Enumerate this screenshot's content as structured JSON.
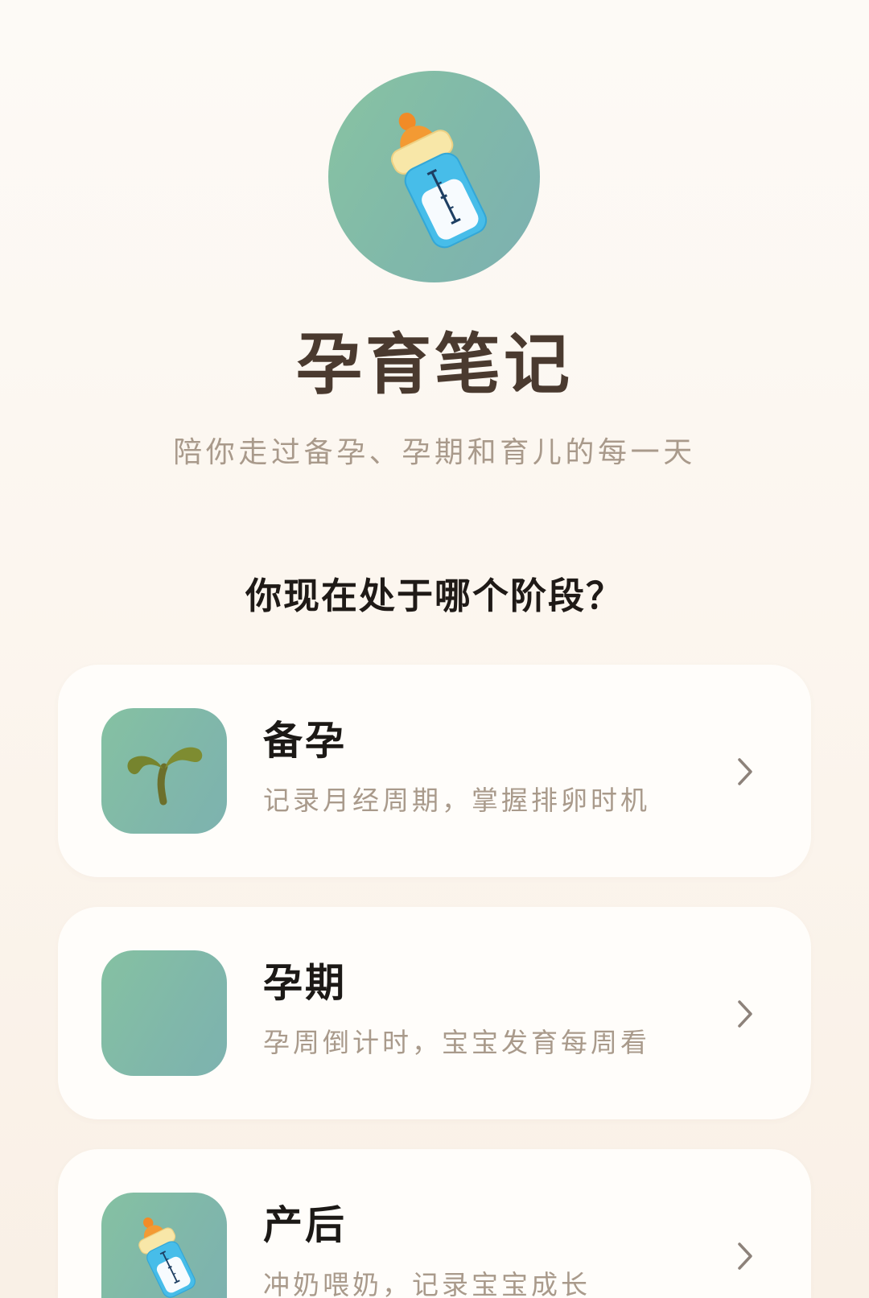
{
  "app": {
    "title": "孕育笔记",
    "subtitle": "陪你走过备孕、孕期和育儿的每一天",
    "logo_icon": "baby-bottle-icon"
  },
  "stage_prompt": "你现在处于哪个阶段？",
  "stages": [
    {
      "label": "备孕",
      "description": "记录月经周期，掌握排卵时机",
      "icon": "sprout-icon"
    },
    {
      "label": "孕期",
      "description": "孕周倒计时，宝宝发育每周看"
    },
    {
      "label": "产后",
      "description": "冲奶喂奶，记录宝宝成长",
      "icon": "baby-bottle-icon"
    }
  ],
  "colors": {
    "background": "#fcf6ef",
    "accent": "#82bba7",
    "title": "#4a3a2f",
    "muted_text": "#a99a8b",
    "card": "#fffdfa",
    "chevron": "#8d827a"
  }
}
